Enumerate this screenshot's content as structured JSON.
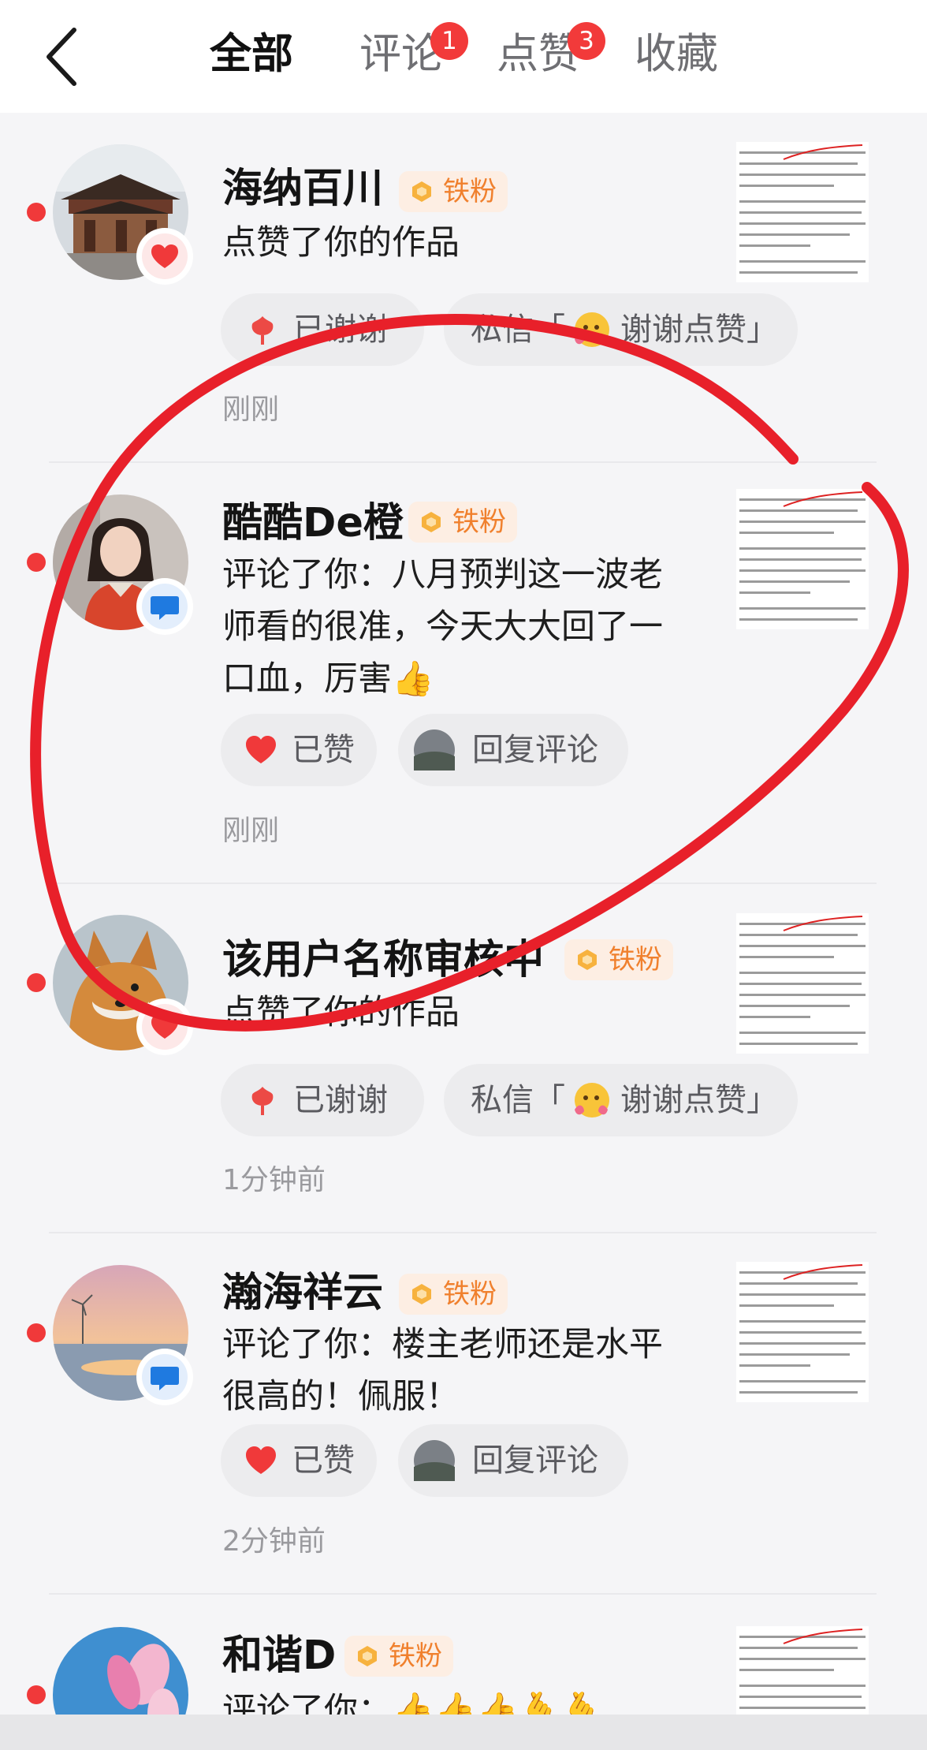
{
  "header": {
    "tabs": [
      {
        "label": "全部",
        "active": true
      },
      {
        "label": "评论",
        "badge": "1"
      },
      {
        "label": "点赞",
        "badge": "3"
      },
      {
        "label": "收藏"
      }
    ]
  },
  "notifications": [
    {
      "name": "海纳百川",
      "fan_label": "铁粉",
      "type": "like",
      "desc": "点赞了你的作品",
      "actions": {
        "thanked_label": "已谢谢",
        "message_prefix": "私信「",
        "message_text": "谢谢点赞」"
      },
      "time": "刚刚"
    },
    {
      "name": "酷酷De橙",
      "fan_label": "铁粉",
      "type": "comment",
      "desc": "评论了你：八月预判这一波老师看的很准，今天大大回了一口血，厉害👍",
      "actions": {
        "liked_label": "已赞",
        "reply_label": "回复评论"
      },
      "time": "刚刚"
    },
    {
      "name": "该用户名称审核中",
      "fan_label": "铁粉",
      "type": "like",
      "desc": "点赞了你的作品",
      "actions": {
        "thanked_label": "已谢谢",
        "message_prefix": "私信「",
        "message_text": "谢谢点赞」"
      },
      "time": "1分钟前"
    },
    {
      "name": "瀚海祥云",
      "fan_label": "铁粉",
      "type": "comment",
      "desc": "评论了你：楼主老师还是水平很高的！佩服！",
      "actions": {
        "liked_label": "已赞",
        "reply_label": "回复评论"
      },
      "time": "2分钟前"
    },
    {
      "name": "和谐D",
      "fan_label": "铁粉",
      "type": "comment",
      "desc": "评论了你：👍👍👍🫰🫰"
    }
  ],
  "colors": {
    "accent_red": "#f0393a",
    "fan_orange": "#f0802d",
    "annotation_red": "#e8202a"
  }
}
